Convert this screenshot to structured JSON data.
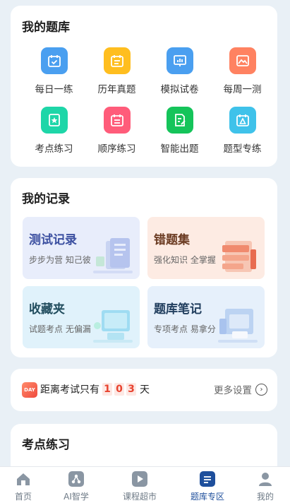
{
  "bank": {
    "title": "我的题库",
    "items": [
      {
        "label": "每日一练",
        "icon": "calendar-check-icon",
        "color": "#4a9ff0"
      },
      {
        "label": "历年真题",
        "icon": "calendar-list-icon",
        "color": "#ffbe1f"
      },
      {
        "label": "模拟试卷",
        "icon": "presentation-chart-icon",
        "color": "#4a9ff0"
      },
      {
        "label": "每周一测",
        "icon": "picture-icon",
        "color": "#ff8261"
      },
      {
        "label": "考点练习",
        "icon": "star-badge-icon",
        "color": "#1ed6a8"
      },
      {
        "label": "顺序练习",
        "icon": "calendar-list-icon",
        "color": "#ff5c7a"
      },
      {
        "label": "智能出题",
        "icon": "document-edit-icon",
        "color": "#15c45a"
      },
      {
        "label": "题型专练",
        "icon": "triangle-warning-icon",
        "color": "#3fc2ea"
      }
    ]
  },
  "records": {
    "title": "我的记录",
    "cards": [
      {
        "title": "测试记录",
        "subtitle": "步步为营 知己彼",
        "title_color": "#3b4fa0",
        "bg": "#e8edfb"
      },
      {
        "title": "错题集",
        "subtitle": "强化知识 全掌握",
        "title_color": "#6b3b22",
        "bg": "#fdebe3"
      },
      {
        "title": "收藏夹",
        "subtitle": "试题考点 无偏漏",
        "title_color": "#214d5e",
        "bg": "#e0f2fb"
      },
      {
        "title": "题库笔记",
        "subtitle": "专项考点 易拿分",
        "title_color": "#213e5e",
        "bg": "#e6f0fb"
      }
    ]
  },
  "countdown": {
    "icon_text": "DAY",
    "prefix": "距离考试只有",
    "digits": [
      "1",
      "0",
      "3"
    ],
    "suffix": "天",
    "more_label": "更多设置"
  },
  "practice": {
    "title": "考点练习"
  },
  "tabbar": {
    "tabs": [
      {
        "label": "首页",
        "icon": "home-icon"
      },
      {
        "label": "AI智学",
        "icon": "ai-network-icon"
      },
      {
        "label": "课程超市",
        "icon": "play-icon"
      },
      {
        "label": "题库专区",
        "icon": "document-icon"
      },
      {
        "label": "我的",
        "icon": "user-icon"
      }
    ],
    "active_index": 3
  }
}
